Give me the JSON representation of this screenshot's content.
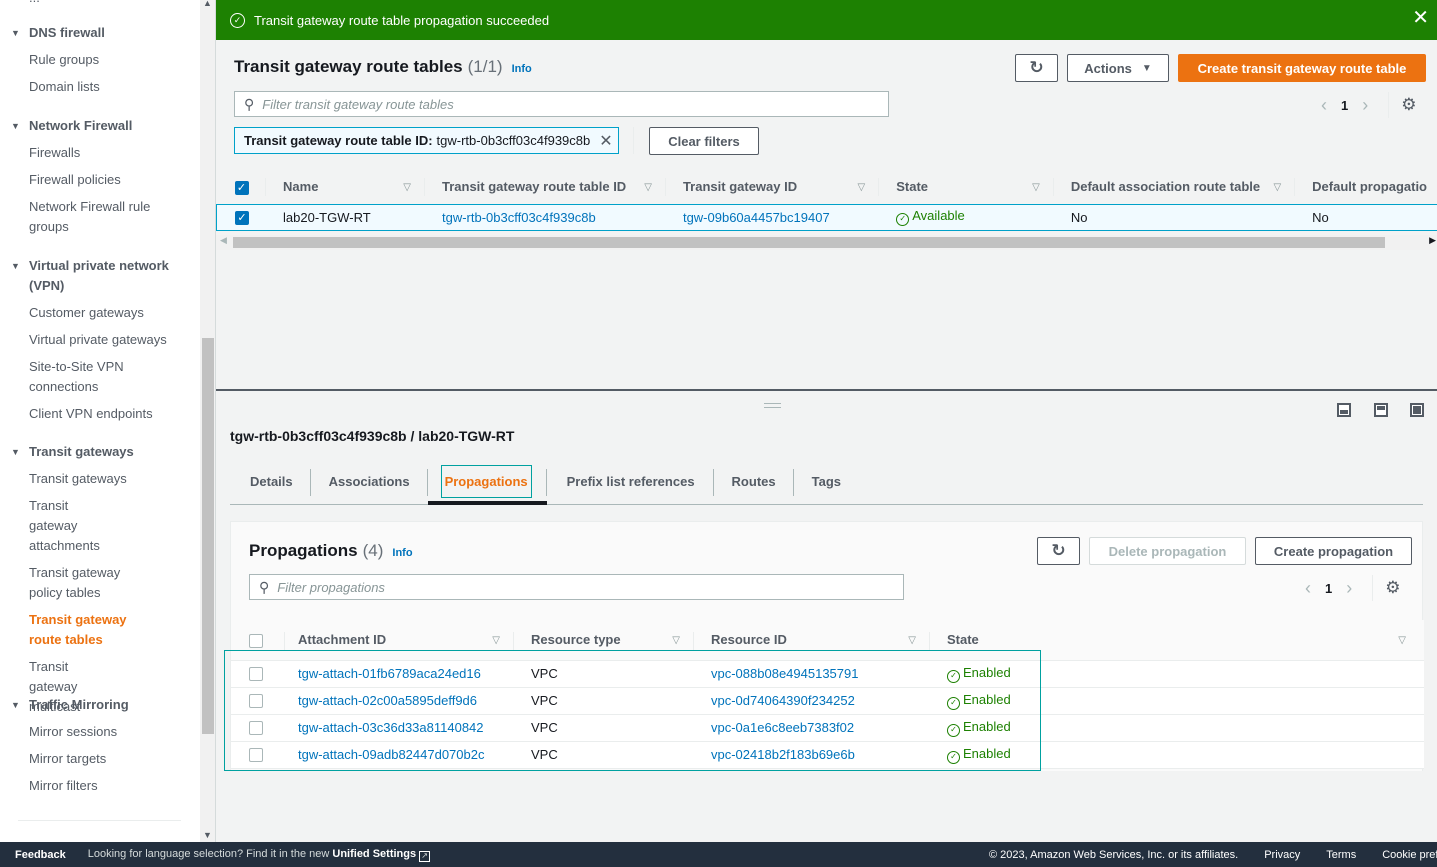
{
  "sidebar": {
    "sections": [
      {
        "title": "DNS firewall",
        "items": [
          {
            "label": "Rule groups"
          },
          {
            "label": "Domain lists"
          }
        ]
      },
      {
        "title": "Network Firewall",
        "items": [
          {
            "label": "Firewalls"
          },
          {
            "label": "Firewall policies"
          },
          {
            "label": "Network Firewall rule groups"
          }
        ]
      },
      {
        "title": "Virtual private network (VPN)",
        "items": [
          {
            "label": "Customer gateways"
          },
          {
            "label": "Virtual private gateways"
          },
          {
            "label": "Site-to-Site VPN connections"
          },
          {
            "label": "Client VPN endpoints"
          }
        ]
      },
      {
        "title": "Transit gateways",
        "items": [
          {
            "label": "Transit gateways"
          },
          {
            "label": "Transit gateway attachments"
          },
          {
            "label": "Transit gateway policy tables"
          },
          {
            "label": "Transit gateway route tables",
            "active": true
          },
          {
            "label": "Transit gateway multicast"
          }
        ]
      },
      {
        "title": "Traffic Mirroring",
        "items": [
          {
            "label": "Mirror sessions"
          },
          {
            "label": "Mirror targets"
          },
          {
            "label": "Mirror filters"
          }
        ]
      }
    ]
  },
  "flash": {
    "message": "Transit gateway route table propagation succeeded",
    "type": "success"
  },
  "route_tables": {
    "title": "Transit gateway route tables",
    "count": "(1/1)",
    "info": "Info",
    "actions_label": "Actions",
    "create_label": "Create transit gateway route table",
    "filter_placeholder": "Filter transit gateway route tables",
    "token_key": "Transit gateway route table ID:",
    "token_value": "tgw-rtb-0b3cff03c4f939c8b",
    "clear_filters": "Clear filters",
    "page": "1",
    "columns": [
      "Name",
      "Transit gateway route table ID",
      "Transit gateway ID",
      "State",
      "Default association route table",
      "Default propagatio"
    ],
    "rows": [
      {
        "name": "lab20-TGW-RT",
        "rtb_id": "tgw-rtb-0b3cff03c4f939c8b",
        "tgw_id": "tgw-09b60a4457bc19407",
        "state": "Available",
        "default_assoc": "No",
        "default_prop": "No",
        "selected": true
      }
    ]
  },
  "split_panel": {
    "title": "tgw-rtb-0b3cff03c4f939c8b / lab20-TGW-RT",
    "tabs": [
      {
        "label": "Details"
      },
      {
        "label": "Associations"
      },
      {
        "label": "Propagations",
        "active": true
      },
      {
        "label": "Prefix list references"
      },
      {
        "label": "Routes"
      },
      {
        "label": "Tags"
      }
    ]
  },
  "propagations": {
    "title": "Propagations",
    "count": "(4)",
    "info": "Info",
    "delete_label": "Delete propagation",
    "create_label": "Create propagation",
    "filter_placeholder": "Filter propagations",
    "page": "1",
    "columns": [
      "Attachment ID",
      "Resource type",
      "Resource ID",
      "State"
    ],
    "rows": [
      {
        "attachment_id": "tgw-attach-01fb6789aca24ed16",
        "resource_type": "VPC",
        "resource_id": "vpc-088b08e4945135791",
        "state": "Enabled"
      },
      {
        "attachment_id": "tgw-attach-02c00a5895deff9d6",
        "resource_type": "VPC",
        "resource_id": "vpc-0d74064390f234252",
        "state": "Enabled"
      },
      {
        "attachment_id": "tgw-attach-03c36d33a81140842",
        "resource_type": "VPC",
        "resource_id": "vpc-0a1e6c8eeb7383f02",
        "state": "Enabled"
      },
      {
        "attachment_id": "tgw-attach-09adb82447d070b2c",
        "resource_type": "VPC",
        "resource_id": "vpc-02418b2f183b69e6b",
        "state": "Enabled"
      }
    ]
  },
  "footer": {
    "feedback": "Feedback",
    "language_msg": "Looking for language selection? Find it in the new",
    "unified_settings": "Unified Settings",
    "copyright": "© 2023, Amazon Web Services, Inc. or its affiliates.",
    "privacy": "Privacy",
    "terms": "Terms",
    "cookie": "Cookie prefer"
  },
  "colors": {
    "accent": "#ec7211",
    "link": "#0073bb",
    "success": "#1d8102",
    "footer_bg": "#232f3e"
  }
}
